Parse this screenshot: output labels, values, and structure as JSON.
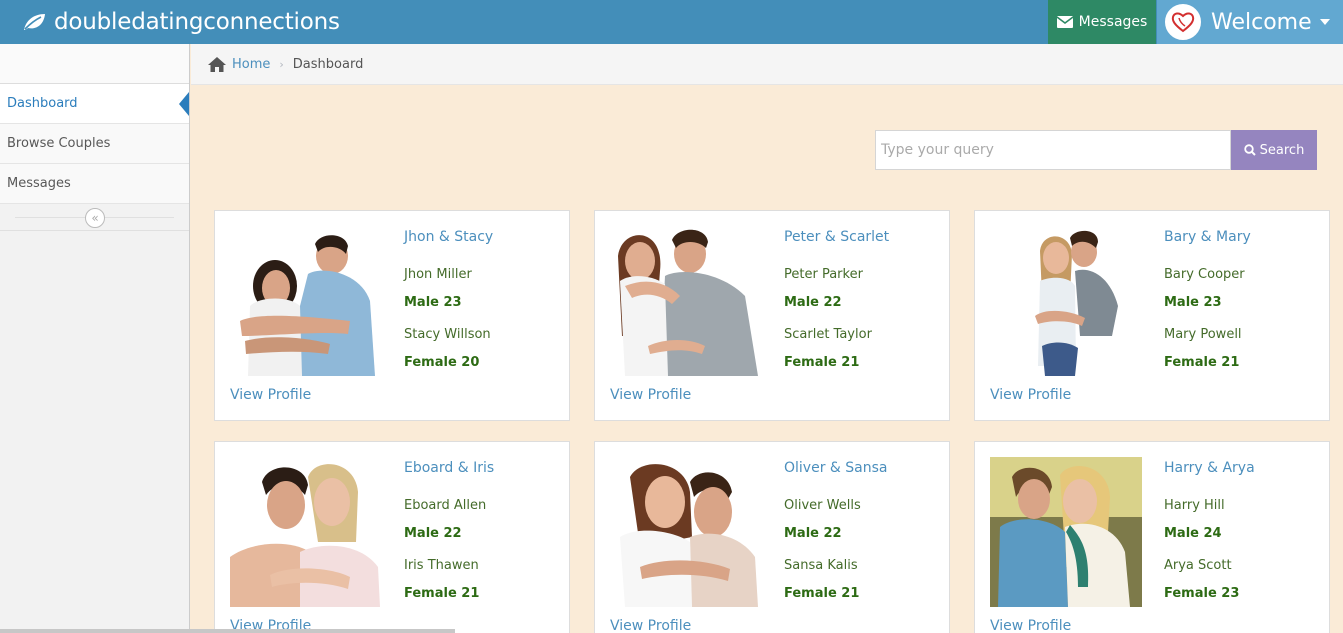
{
  "brand": {
    "name": "doubledatingconnections"
  },
  "nav": {
    "messages_label": "Messages",
    "welcome_label": "Welcome"
  },
  "sidebar": {
    "items": [
      {
        "label": "Dashboard",
        "active": true
      },
      {
        "label": "Browse Couples",
        "active": false
      },
      {
        "label": "Messages",
        "active": false
      }
    ]
  },
  "breadcrumb": {
    "home": "Home",
    "current": "Dashboard"
  },
  "search": {
    "placeholder": "Type your query",
    "button_label": "Search"
  },
  "couples": [
    {
      "names": "Jhon & Stacy",
      "p1": "Jhon Miller",
      "g1": "Male 23",
      "p2": "Stacy Willson",
      "g2": "Female 20",
      "link": "View Profile"
    },
    {
      "names": "Peter & Scarlet",
      "p1": "Peter Parker",
      "g1": "Male 22",
      "p2": "Scarlet Taylor",
      "g2": "Female 21",
      "link": "View Profile"
    },
    {
      "names": "Bary & Mary",
      "p1": "Bary Cooper",
      "g1": "Male 23",
      "p2": "Mary Powell",
      "g2": "Female 21",
      "link": "View Profile"
    },
    {
      "names": "Eboard & Iris",
      "p1": "Eboard Allen",
      "g1": "Male 22",
      "p2": "Iris Thawen",
      "g2": "Female 21",
      "link": "View Profile"
    },
    {
      "names": "Oliver & Sansa",
      "p1": "Oliver Wells",
      "g1": "Male 22",
      "p2": "Sansa Kalis",
      "g2": "Female 21",
      "link": "View Profile"
    },
    {
      "names": "Harry & Arya",
      "p1": "Harry Hill",
      "g1": "Male 24",
      "p2": "Arya Scott",
      "g2": "Female 23",
      "link": "View Profile"
    }
  ],
  "colors": {
    "navbar": "#438eb9",
    "messages_bg": "#2e8965",
    "user_bg": "#62a8d1",
    "content_bg": "#faebd7",
    "search_button": "#9585bf",
    "link": "#4c8fbd",
    "gender_text": "#2d6b14"
  }
}
